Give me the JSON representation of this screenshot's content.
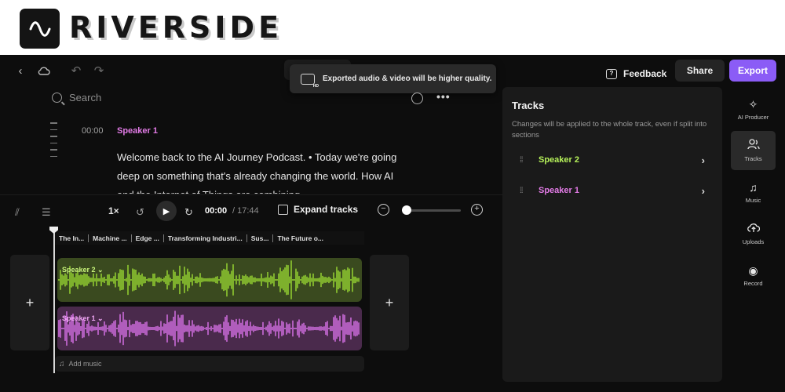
{
  "brand": {
    "name": "RIVERSIDE"
  },
  "toolbar": {
    "toast": "Exported audio & video will be higher quality.",
    "feedback_label": "Feedback",
    "share_label": "Share",
    "export_label": "Export",
    "accent_color": "#8b5cf6"
  },
  "search": {
    "placeholder": "Search"
  },
  "transcript": {
    "timestamp": "00:00",
    "speaker": "Speaker 1",
    "text": "Welcome back to the AI Journey Podcast. • Today we're going deep on something that's already changing the world. How AI and the Internet of Things are combining. •"
  },
  "player": {
    "speed": "1×",
    "current_time": "00:00",
    "total_time": "/ 17:44",
    "expand_label": "Expand tracks",
    "zoom_level": 0.05
  },
  "chapters": [
    "The In...",
    "Machine ...",
    "Edge ...",
    "Transforming Industri...",
    "Sus...",
    "The Future o..."
  ],
  "tracks_timeline": [
    {
      "name": "Speaker 2",
      "color": "#a3e635"
    },
    {
      "name": "Speaker 1",
      "color": "#e879f9"
    }
  ],
  "add_music_label": "Add music",
  "panel": {
    "title": "Tracks",
    "description": "Changes will be applied to the whole track, even if split into sections",
    "rows": [
      {
        "name": "Speaker 2",
        "color": "#b6f25a"
      },
      {
        "name": "Speaker 1",
        "color": "#e27be6"
      }
    ]
  },
  "sidebar": {
    "items": [
      {
        "label": "AI Producer",
        "icon": "sparkle-icon"
      },
      {
        "label": "Tracks",
        "icon": "users-icon"
      },
      {
        "label": "Music",
        "icon": "music-icon"
      },
      {
        "label": "Uploads",
        "icon": "upload-cloud-icon"
      },
      {
        "label": "Record",
        "icon": "record-icon"
      }
    ]
  }
}
